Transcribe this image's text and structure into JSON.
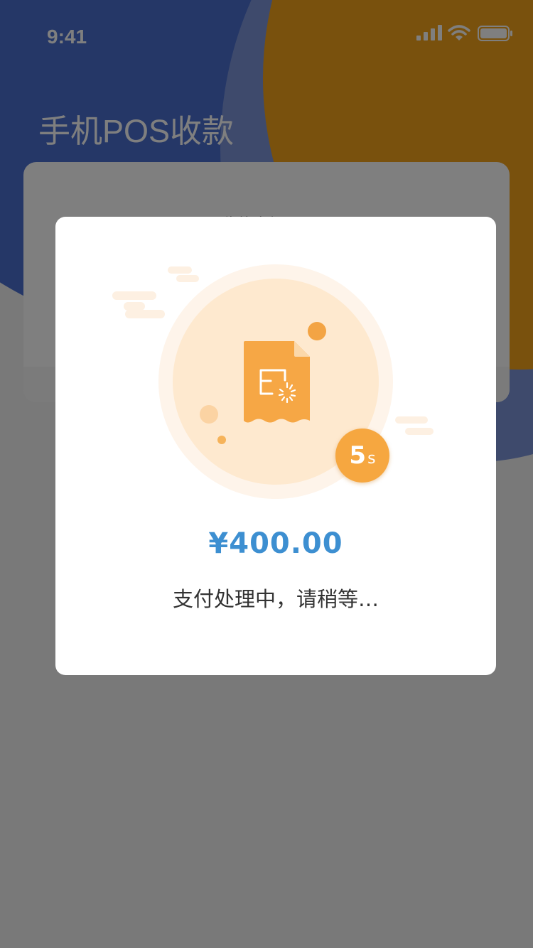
{
  "status_bar": {
    "time": "9:41"
  },
  "page": {
    "title": "手机POS收款"
  },
  "background_card": {
    "label": "收款金额(元)"
  },
  "modal": {
    "timer_value": "5",
    "timer_unit": "s",
    "amount": "¥400.00",
    "status": "支付处理中，请稍等…"
  },
  "icons": [
    "signal-icon",
    "wifi-icon",
    "battery-icon",
    "receipt-icon",
    "loading-spinner-icon"
  ],
  "colors": {
    "primary_blue": "#4a6fcf",
    "accent_orange": "#f2a21a",
    "amount_blue": "#3d8fd1",
    "badge_orange": "#f6a740"
  }
}
